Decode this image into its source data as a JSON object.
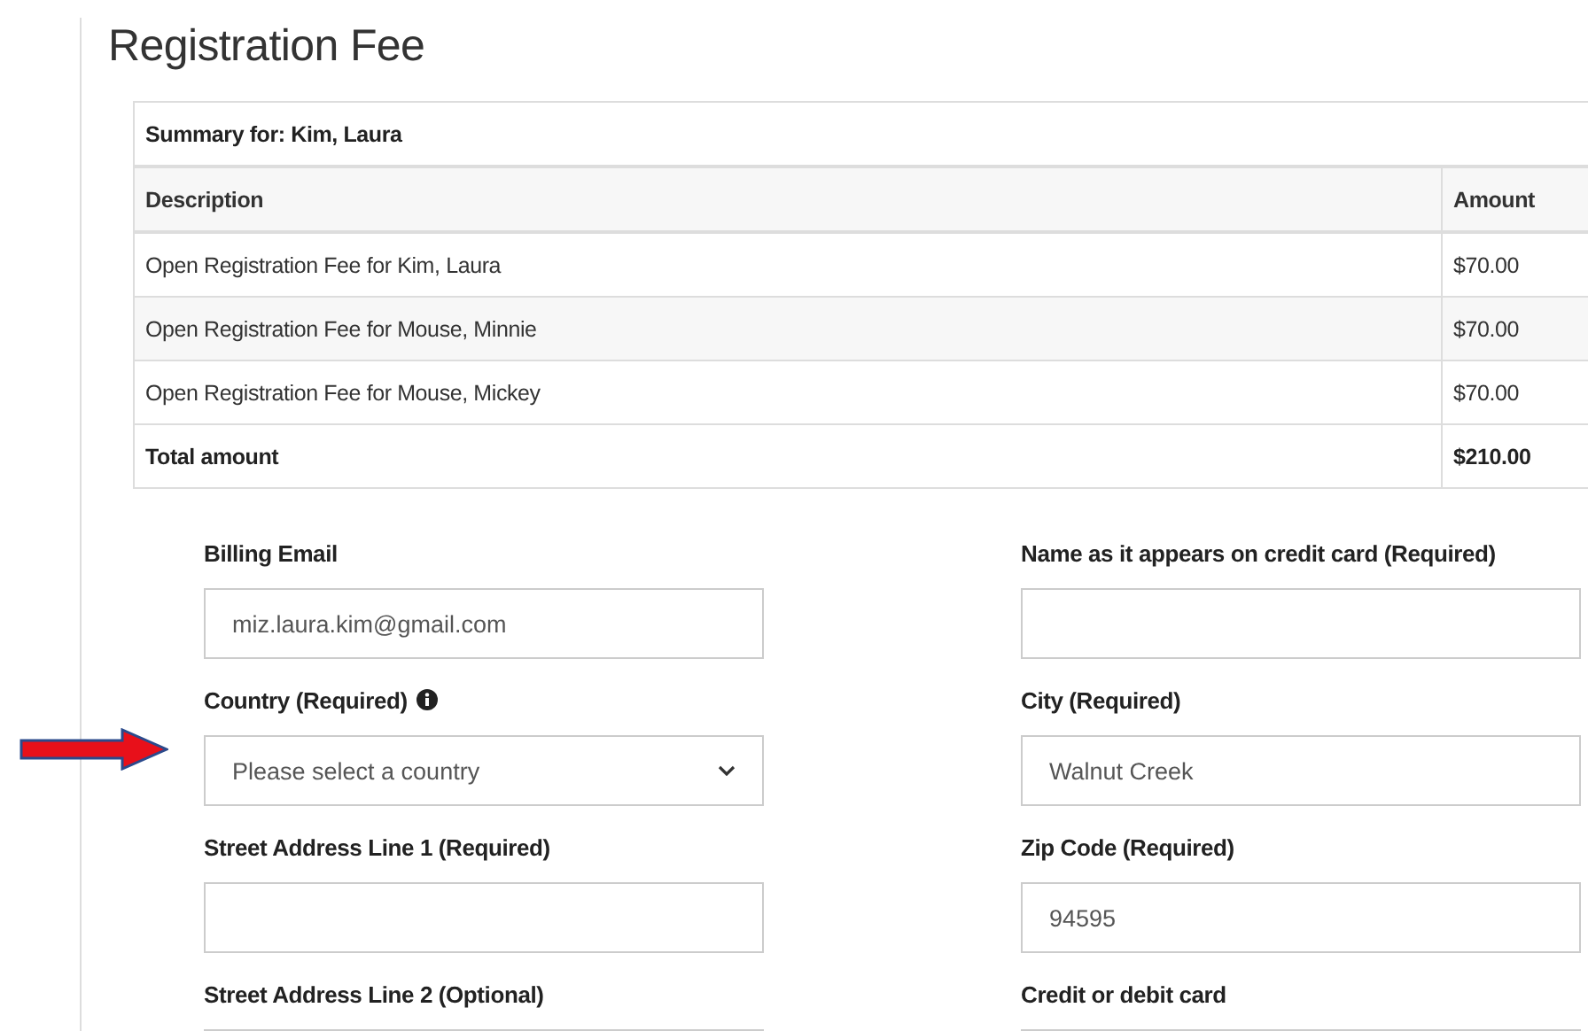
{
  "title": "Registration Fee",
  "summary": {
    "heading": "Summary for: Kim, Laura",
    "columns": [
      "Description",
      "Amount"
    ],
    "rows": [
      {
        "description": "Open Registration Fee for Kim, Laura",
        "amount": "$70.00"
      },
      {
        "description": "Open Registration Fee for Mouse, Minnie",
        "amount": "$70.00"
      },
      {
        "description": "Open Registration Fee for Mouse, Mickey",
        "amount": "$70.00"
      }
    ],
    "total": {
      "label": "Total amount",
      "amount": "$210.00"
    }
  },
  "fields": [
    {
      "label": "Billing Email",
      "kind": "input",
      "value": "miz.laura.kim@gmail.com",
      "info": false
    },
    {
      "label": "Name as it appears on credit card (Required)",
      "kind": "input",
      "info": false
    },
    {
      "label": "Country (Required)",
      "kind": "select",
      "value": "Please select a country",
      "info": true
    },
    {
      "label": "City (Required)",
      "kind": "input",
      "value": "Walnut Creek",
      "info": false
    },
    {
      "label": "Street Address Line 1 (Required)",
      "kind": "input",
      "info": false
    },
    {
      "label": "Zip Code (Required)",
      "kind": "input",
      "value": "94595",
      "info": false
    },
    {
      "label": "Street Address Line 2 (Optional)",
      "kind": "input",
      "info": false
    },
    {
      "label": "Credit or debit card",
      "kind": "input",
      "info": false
    }
  ]
}
